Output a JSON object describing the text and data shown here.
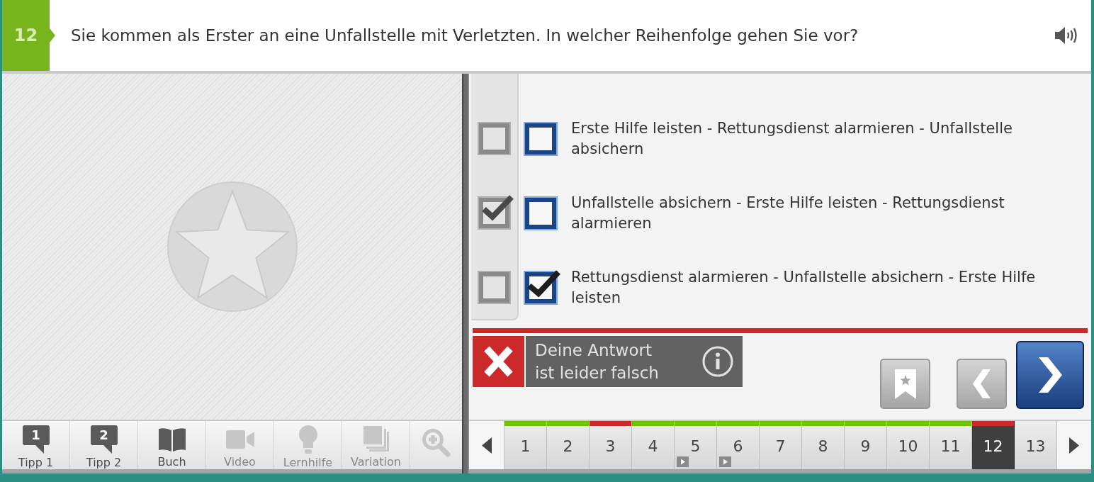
{
  "header": {
    "number": "12",
    "question": "Sie kommen als Erster an eine Unfallstelle mit Verletzten. In welcher Reihenfolge gehen Sie vor?"
  },
  "answers": [
    {
      "text": "Erste Hilfe leisten - Rettungsdienst alarmieren - Unfallstelle absichern",
      "solution_checked": false,
      "checked": false
    },
    {
      "text": "Unfallstelle absichern - Erste Hilfe leisten - Rettungsdienst alarmieren",
      "solution_checked": true,
      "checked": false
    },
    {
      "text": "Rettungsdienst alarmieren - Unfallstelle absichern - Erste Hilfe leisten",
      "solution_checked": false,
      "checked": true
    }
  ],
  "feedback": {
    "correct": false,
    "text": "Deine Antwort\nist leider falsch"
  },
  "buttons": [
    {
      "kind": "bookmark"
    },
    {
      "kind": "previous"
    },
    {
      "kind": "next"
    }
  ],
  "tools": [
    {
      "kind": "hint",
      "label": "Tipp 1",
      "badge": "1",
      "disabled": false
    },
    {
      "kind": "hint",
      "label": "Tipp 2",
      "badge": "2",
      "disabled": false
    },
    {
      "kind": "book",
      "label": "Buch",
      "disabled": false
    },
    {
      "kind": "video",
      "label": "Video",
      "disabled": true
    },
    {
      "kind": "bulb",
      "label": "Lernhilfe",
      "disabled": true
    },
    {
      "kind": "layers",
      "label": "Variation",
      "disabled": true
    },
    {
      "kind": "zoom",
      "disabled": true
    }
  ],
  "pagination": {
    "pages": [
      {
        "label": "1",
        "color": "#6fc400",
        "has_video": false,
        "selected": false
      },
      {
        "label": "2",
        "color": "#6fc400",
        "has_video": false,
        "selected": false
      },
      {
        "label": "3",
        "color": "#cc2a2a",
        "has_video": false,
        "selected": false
      },
      {
        "label": "4",
        "color": "#6fc400",
        "has_video": false,
        "selected": false
      },
      {
        "label": "5",
        "color": "#6fc400",
        "has_video": true,
        "selected": false
      },
      {
        "label": "6",
        "color": "#6fc400",
        "has_video": true,
        "selected": false
      },
      {
        "label": "7",
        "color": "#6fc400",
        "has_video": false,
        "selected": false
      },
      {
        "label": "8",
        "color": "#6fc400",
        "has_video": false,
        "selected": false
      },
      {
        "label": "9",
        "color": "#6fc400",
        "has_video": false,
        "selected": false
      },
      {
        "label": "10",
        "color": "#6fc400",
        "has_video": false,
        "selected": false
      },
      {
        "label": "11",
        "color": "#6fc400",
        "has_video": false,
        "selected": false
      },
      {
        "label": "12",
        "color": "#cc2a2a",
        "has_video": false,
        "selected": true
      },
      {
        "label": "13",
        "has_video": false,
        "selected": false
      }
    ]
  }
}
